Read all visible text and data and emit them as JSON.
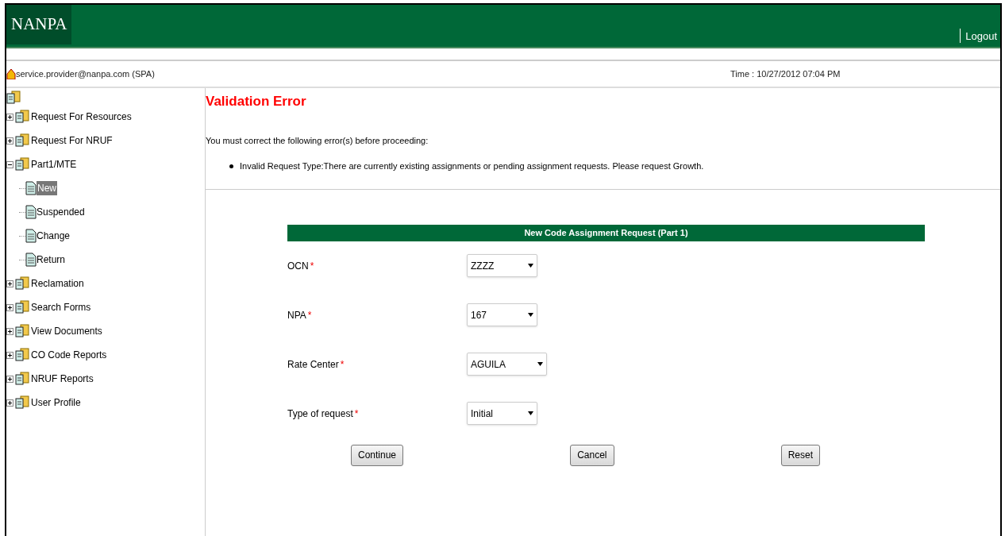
{
  "header": {
    "logo": "NANPA",
    "logout": "Logout"
  },
  "user_bar": {
    "user": "service.provider@nanpa.com (SPA)",
    "time": "Time : 10/27/2012 07:04 PM"
  },
  "sidebar": {
    "items": [
      {
        "label": "Request For Resources",
        "expanded": false,
        "selected": false
      },
      {
        "label": "Request For NRUF",
        "expanded": false,
        "selected": false
      },
      {
        "label": "Part1/MTE",
        "expanded": true,
        "selected": false,
        "children": [
          {
            "label": "New",
            "selected": true
          },
          {
            "label": "Suspended",
            "selected": false
          },
          {
            "label": "Change",
            "selected": false
          },
          {
            "label": "Return",
            "selected": false
          }
        ]
      },
      {
        "label": "Reclamation",
        "expanded": false,
        "selected": false
      },
      {
        "label": "Search Forms",
        "expanded": false,
        "selected": false
      },
      {
        "label": "View Documents",
        "expanded": false,
        "selected": false
      },
      {
        "label": "CO Code Reports",
        "expanded": false,
        "selected": false
      },
      {
        "label": "NRUF Reports",
        "expanded": false,
        "selected": false
      },
      {
        "label": "User Profile",
        "expanded": false,
        "selected": false
      }
    ]
  },
  "error": {
    "title": "Validation Error",
    "intro": "You must correct the following error(s) before proceeding:",
    "messages": [
      "Invalid Request Type:There are currently existing assignments or pending assignment requests. Please request Growth."
    ]
  },
  "form": {
    "title": "New Code Assignment Request (Part 1)",
    "fields": [
      {
        "label": "OCN",
        "required_mark": "*",
        "value": "ZZZZ"
      },
      {
        "label": "NPA",
        "required_mark": "*",
        "value": "167"
      },
      {
        "label": "Rate Center",
        "required_mark": "*",
        "value": "AGUILA"
      },
      {
        "label": "Type of request",
        "required_mark": "*",
        "value": "Initial"
      }
    ],
    "buttons": [
      "Continue",
      "Cancel",
      "Reset"
    ]
  }
}
